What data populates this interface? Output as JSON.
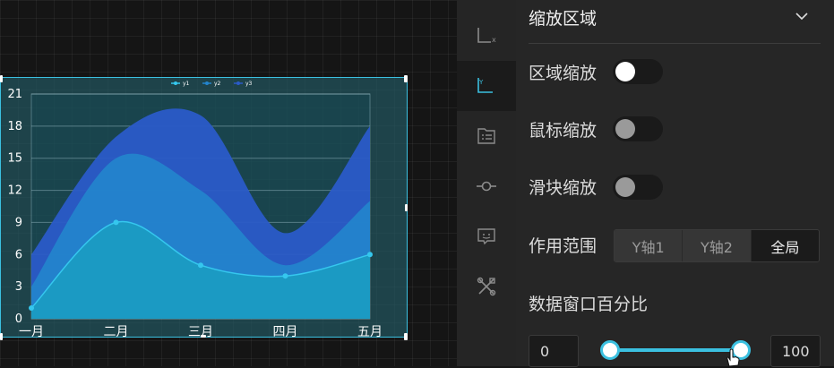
{
  "chart_data": {
    "type": "area",
    "categories": [
      "一月",
      "二月",
      "三月",
      "四月",
      "五月"
    ],
    "series": [
      {
        "name": "y1",
        "values": [
          1,
          9,
          5,
          4,
          6
        ]
      },
      {
        "name": "y2",
        "values": [
          2,
          6,
          7,
          1,
          5
        ]
      },
      {
        "name": "y3",
        "values": [
          3,
          2,
          7,
          3,
          7
        ]
      }
    ],
    "stacked": true,
    "ylim": [
      0,
      21
    ],
    "yticks": [
      0,
      3,
      6,
      9,
      12,
      15,
      18,
      21
    ],
    "grid": true,
    "legend": "top-center",
    "colors": [
      "#1b9bc2",
      "#2384cc",
      "#2a5bc8"
    ],
    "line_color": "#35c7ee"
  },
  "rail": {
    "items": [
      {
        "icon": "x-axis-icon"
      },
      {
        "icon": "y-axis-icon"
      },
      {
        "icon": "legend-icon"
      },
      {
        "icon": "series-icon"
      },
      {
        "icon": "tooltip-icon"
      },
      {
        "icon": "tools-icon"
      }
    ]
  },
  "panel": {
    "title": "缩放区域",
    "area_zoom_label": "区域缩放",
    "area_zoom_on": true,
    "mouse_zoom_label": "鼠标缩放",
    "mouse_zoom_on": false,
    "slider_zoom_label": "滑块缩放",
    "slider_zoom_on": false,
    "scope_label": "作用范围",
    "scope_options": [
      "Y轴1",
      "Y轴2",
      "全局"
    ],
    "scope_selected": "全局",
    "window_label": "数据窗口百分比",
    "window_start": "0",
    "window_end": "100",
    "accent": "#3bc0e0"
  }
}
